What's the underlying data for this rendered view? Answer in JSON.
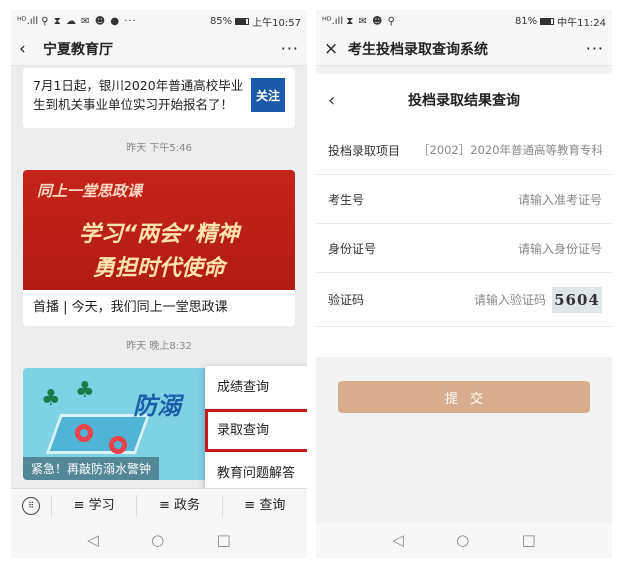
{
  "left": {
    "status": {
      "carrier": "ᴴᴰ.ıll",
      "icons": "⚲ ⧗ ☁ ✉ ☻ ● ···",
      "battery_pct": "85%",
      "time": "上午10:57",
      "battery_level": 0.85
    },
    "nav": {
      "title": "宁夏教育厅",
      "more": "···"
    },
    "notice": {
      "text": "7月1日起，银川2020年普通高校毕业生到机关事业单位实习开始报名了！",
      "follow_label": "关注"
    },
    "time1": "昨天 下午5:46",
    "banner": {
      "line1": "同上一堂思政课",
      "line2": "学习“两会”精神",
      "line3": "勇担时代使命"
    },
    "article_title": "首播 | 今天，我们同上一堂思政课",
    "time2": "昨天 晚上8:32",
    "swim": {
      "word": "防溺",
      "warning": "紧急！再敲防溺水警钟"
    },
    "menu": [
      "成绩查询",
      "录取查询",
      "教育问题解答"
    ],
    "tabs": [
      "≡ 学习",
      "≡ 政务",
      "≡ 查询"
    ],
    "keyboard_icon": "keyboard-icon"
  },
  "right": {
    "status": {
      "carrier": "ᴴᴰ.ıll",
      "icons": "⧗ ✉ ☻ ⚲",
      "battery_pct": "81%",
      "time": "中午11:24",
      "battery_level": 0.81
    },
    "nav": {
      "close": "×",
      "title": "考生投档录取查询系统",
      "more": "···"
    },
    "page_title": "投档录取结果查询",
    "form": {
      "project_label": "投档录取项目",
      "project_value": "［2002］2020年普通高等教育专科 ▾",
      "exam_label": "考生号",
      "exam_placeholder": "请输入准考证号",
      "id_label": "身份证号",
      "id_placeholder": "请输入身份证号",
      "captcha_label": "验证码",
      "captcha_placeholder": "请输入验证码",
      "captcha_image_text": "5604"
    },
    "submit_label": "提交"
  },
  "sysnav": {
    "back": "◁",
    "home": "○",
    "recent": "□"
  }
}
